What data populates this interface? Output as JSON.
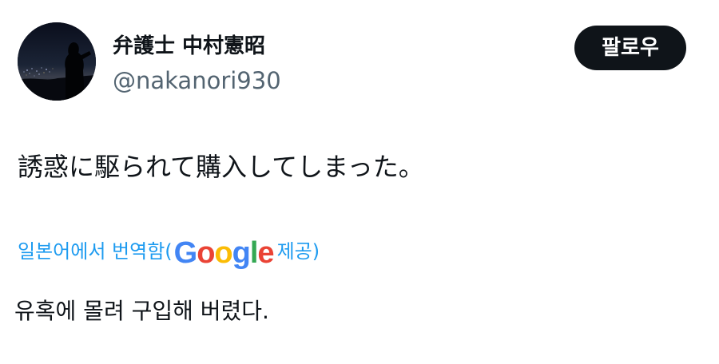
{
  "author": {
    "display_name": "弁護士 中村憲昭",
    "handle": "@nakanori930",
    "avatar": "night-city-silhouette-avatar"
  },
  "follow_button": {
    "label": "팔로우"
  },
  "tweet": {
    "text": "誘惑に駆られて購入してしまった。"
  },
  "translation": {
    "label": "일본어에서 번역함(",
    "provider_logo": {
      "letters": [
        "G",
        "o",
        "o",
        "g",
        "l",
        "e"
      ],
      "colors": [
        "#4285f4",
        "#ea4335",
        "#fbbc05",
        "#4285f4",
        "#34a853",
        "#ea4335"
      ]
    },
    "provided_label": "제공)",
    "text": "유혹에 몰려 구입해 버렸다."
  },
  "colors": {
    "link": "#1d9bf0",
    "text_primary": "#0f1419",
    "text_secondary": "#536471",
    "button_bg": "#0f1419",
    "button_text": "#ffffff"
  }
}
